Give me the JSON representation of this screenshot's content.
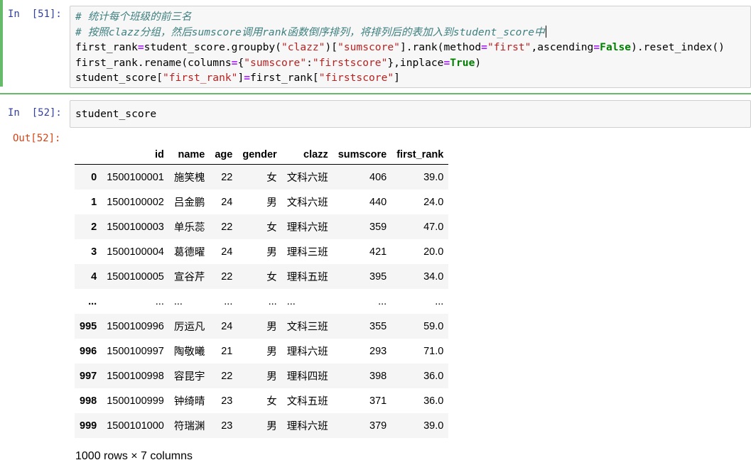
{
  "cell51": {
    "prompt": "In  [51]:",
    "lines": [
      [
        {
          "t": "# 统计每个班级的前三名",
          "c": "cm"
        }
      ],
      [
        {
          "t": "# 按照clazz分组，然后sumscore调用rank函数倒序排列，将排列后的表加入到student_score中",
          "c": "cm"
        }
      ],
      [
        {
          "t": "first_rank"
        },
        {
          "t": "=",
          "c": "op"
        },
        {
          "t": "student_score.groupby("
        },
        {
          "t": "\"clazz\"",
          "c": "st"
        },
        {
          "t": ")["
        },
        {
          "t": "\"sumscore\"",
          "c": "st"
        },
        {
          "t": "].rank(method"
        },
        {
          "t": "=",
          "c": "op"
        },
        {
          "t": "\"first\"",
          "c": "st"
        },
        {
          "t": ",ascending"
        },
        {
          "t": "=",
          "c": "op"
        },
        {
          "t": "False",
          "c": "kw"
        },
        {
          "t": ").reset_index()"
        }
      ],
      [
        {
          "t": "first_rank.rename(columns"
        },
        {
          "t": "=",
          "c": "op"
        },
        {
          "t": "{"
        },
        {
          "t": "\"sumscore\"",
          "c": "st"
        },
        {
          "t": ":"
        },
        {
          "t": "\"firstscore\"",
          "c": "st"
        },
        {
          "t": "},inplace"
        },
        {
          "t": "=",
          "c": "op"
        },
        {
          "t": "True",
          "c": "kw"
        },
        {
          "t": ")"
        }
      ],
      [
        {
          "t": "student_score["
        },
        {
          "t": "\"first_rank\"",
          "c": "st"
        },
        {
          "t": "]"
        },
        {
          "t": "=",
          "c": "op"
        },
        {
          "t": "first_rank["
        },
        {
          "t": "\"firstscore\"",
          "c": "st"
        },
        {
          "t": "]"
        }
      ]
    ]
  },
  "cell52": {
    "prompt": "In  [52]:",
    "code": "student_score",
    "out_prompt": "Out[52]:"
  },
  "dataframe": {
    "columns": [
      "",
      "id",
      "name",
      "age",
      "gender",
      "clazz",
      "sumscore",
      "first_rank"
    ],
    "rows": [
      [
        "0",
        "1500100001",
        "施笑槐",
        "22",
        "女",
        "文科六班",
        "406",
        "39.0"
      ],
      [
        "1",
        "1500100002",
        "吕金鹏",
        "24",
        "男",
        "文科六班",
        "440",
        "24.0"
      ],
      [
        "2",
        "1500100003",
        "单乐蕊",
        "22",
        "女",
        "理科六班",
        "359",
        "47.0"
      ],
      [
        "3",
        "1500100004",
        "葛德曜",
        "24",
        "男",
        "理科三班",
        "421",
        "20.0"
      ],
      [
        "4",
        "1500100005",
        "宣谷芹",
        "22",
        "女",
        "理科五班",
        "395",
        "34.0"
      ],
      [
        "...",
        "...",
        "...",
        "...",
        "...",
        "...",
        "...",
        "..."
      ],
      [
        "995",
        "1500100996",
        "厉运凡",
        "24",
        "男",
        "文科三班",
        "355",
        "59.0"
      ],
      [
        "996",
        "1500100997",
        "陶敬曦",
        "21",
        "男",
        "理科六班",
        "293",
        "71.0"
      ],
      [
        "997",
        "1500100998",
        "容昆宇",
        "22",
        "男",
        "理科四班",
        "398",
        "36.0"
      ],
      [
        "998",
        "1500100999",
        "钟绮晴",
        "23",
        "女",
        "文科五班",
        "371",
        "36.0"
      ],
      [
        "999",
        "1500101000",
        "符瑞渊",
        "23",
        "男",
        "理科六班",
        "379",
        "39.0"
      ]
    ],
    "shape_text": "1000 rows × 7 columns"
  }
}
